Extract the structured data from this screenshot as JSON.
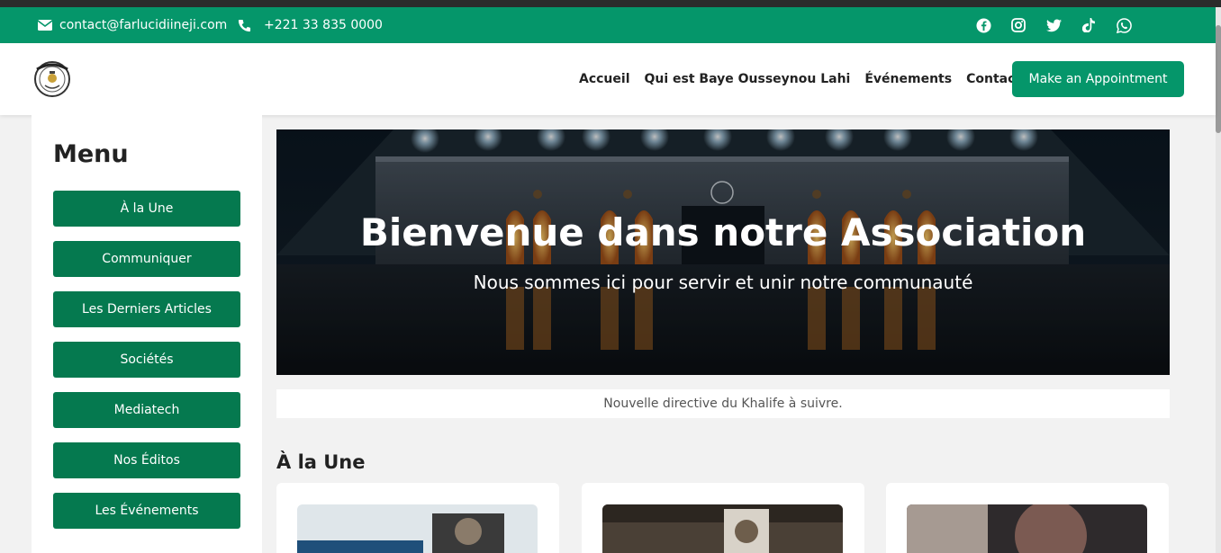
{
  "topbar": {
    "email": "contact@farlucidiineji.com",
    "phone": "+221 33 835 0000",
    "socials": [
      "facebook-icon",
      "instagram-icon",
      "twitter-icon",
      "tiktok-icon",
      "whatsapp-icon"
    ]
  },
  "nav": {
    "links": [
      "Accueil",
      "Qui est Baye Ousseynou Lahi",
      "Événements",
      "Contact"
    ],
    "cta": "Make an Appointment"
  },
  "sidebar": {
    "title": "Menu",
    "items": [
      "À la Une",
      "Communiquer",
      "Les Derniers Articles",
      "Sociétés",
      "Mediatech",
      "Nos Éditos",
      "Les Événements"
    ]
  },
  "hero": {
    "title": "Bienvenue dans notre Association",
    "subtitle": "Nous sommes ici pour servir et unir notre communauté"
  },
  "notice": "Nouvelle directive du Khalife à suivre.",
  "section": {
    "title": "À la Une"
  },
  "colors": {
    "brand": "#05966a",
    "button": "#05794f"
  }
}
